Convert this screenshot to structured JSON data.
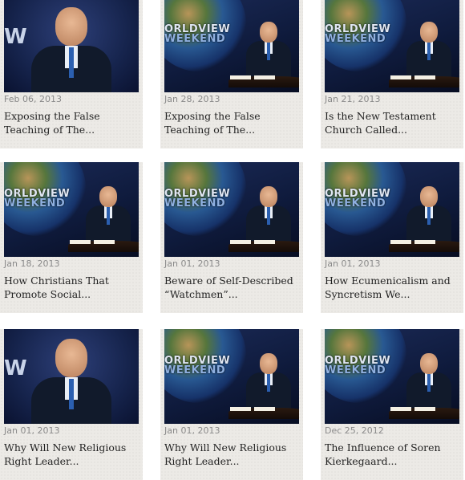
{
  "brand": {
    "logo_line1": "ORLDVIEW",
    "logo_line2": "WEEKEND",
    "logo_close": "W"
  },
  "videos": [
    {
      "date": "Feb 06, 2013",
      "title": "Exposing the False\nTeaching of The..."
    },
    {
      "date": "Jan 28, 2013",
      "title": "Exposing the False\nTeaching of The..."
    },
    {
      "date": "Jan 21, 2013",
      "title": "Is the New Testament\nChurch Called..."
    },
    {
      "date": "Jan 18, 2013",
      "title": "How Christians That\nPromote Social..."
    },
    {
      "date": "Jan 01, 2013",
      "title": "Beware of Self-Described\n“Watchmen”..."
    },
    {
      "date": "Jan 01, 2013",
      "title": "How Ecumenicalism and\nSyncretism We..."
    },
    {
      "date": "Jan 01, 2013",
      "title": "Why Will New Religious\nRight Leader..."
    },
    {
      "date": "Jan 01, 2013",
      "title": "Why Will New Religious\nRight Leader..."
    },
    {
      "date": "Dec 25, 2012",
      "title": "The Influence of Soren\nKierkegaard..."
    }
  ]
}
